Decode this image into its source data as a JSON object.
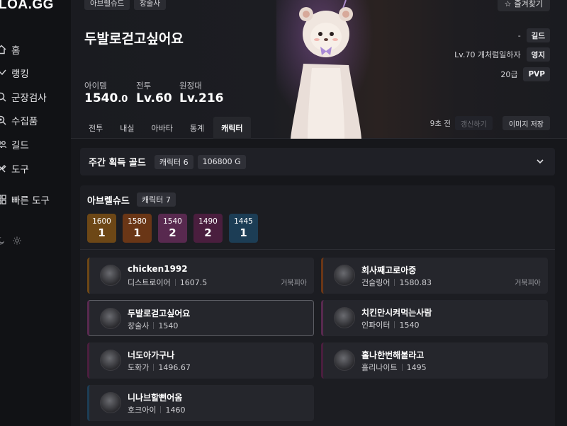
{
  "sidebar": {
    "logo": "LOA.GG",
    "items": [
      {
        "label": "홈",
        "icon": "home-icon"
      },
      {
        "label": "랭킹",
        "icon": "ranking-icon"
      },
      {
        "label": "군장검사",
        "icon": "inspect-icon"
      },
      {
        "label": "수집품",
        "icon": "collection-icon"
      },
      {
        "label": "길드",
        "icon": "guild-icon"
      },
      {
        "label": "도구",
        "icon": "tools-icon"
      },
      {
        "label": "빠른 도구",
        "icon": "quick-tools-icon"
      }
    ]
  },
  "hero": {
    "tags": [
      "아브렐슈드",
      "창술사"
    ],
    "name": "두발로걷고싶어요",
    "stats": [
      {
        "label": "아이템",
        "value": "1540",
        "decimal": ".0"
      },
      {
        "label": "전투",
        "value": "Lv.60"
      },
      {
        "label": "원정대",
        "value": "Lv.216"
      }
    ],
    "favorite_label": "즐겨찾기",
    "info": [
      {
        "text": "-",
        "tag": "길드"
      },
      {
        "text": "Lv.70 개처럼일하자",
        "tag": "영지"
      },
      {
        "text": "20급",
        "tag": "PVP"
      }
    ],
    "tabs": [
      "전투",
      "내실",
      "아바타",
      "통계",
      "캐릭터"
    ],
    "active_tab": "캐릭터",
    "time_ago": "9초 전",
    "refresh_label": "갱신하기",
    "save_image_label": "이미지 저장"
  },
  "gold": {
    "title": "주간 획득 골드",
    "characters": "캐릭터 6",
    "amount": "106800 G"
  },
  "raid": {
    "title": "아브렐슈드",
    "characters": "캐릭터 7",
    "levels": [
      {
        "level": "1600",
        "count": "1",
        "color": "#6d4716"
      },
      {
        "level": "1580",
        "count": "1",
        "color": "#6a3616"
      },
      {
        "level": "1540",
        "count": "2",
        "color": "#58294f"
      },
      {
        "level": "1490",
        "count": "2",
        "color": "#4a1e3e"
      },
      {
        "level": "1445",
        "count": "1",
        "color": "#1c3d55"
      }
    ],
    "cards": [
      {
        "name": "chicken1992",
        "class": "디스트로이어",
        "level": "1607.5",
        "extra": "거북피아",
        "accent": "#6d4716"
      },
      {
        "name": "회사째고로아중",
        "class": "건슬링어",
        "level": "1580.83",
        "extra": "거북피아",
        "accent": "#6a3616"
      },
      {
        "name": "두발로걷고싶어요",
        "class": "창술사",
        "level": "1540",
        "extra": "",
        "accent": "#58294f"
      },
      {
        "name": "치킨만시켜먹는사람",
        "class": "인파이터",
        "level": "1540",
        "extra": "",
        "accent": "#58294f"
      },
      {
        "name": "너도아가구나",
        "class": "도화가",
        "level": "1496.67",
        "extra": "",
        "accent": "#4a1e3e"
      },
      {
        "name": "홀나한번해볼라고",
        "class": "홀리나이트",
        "level": "1495",
        "extra": "",
        "accent": "#4a1e3e"
      },
      {
        "name": "니나브할뻔어옴",
        "class": "호크아이",
        "level": "1460",
        "extra": "",
        "accent": "#1c3d55"
      }
    ]
  }
}
